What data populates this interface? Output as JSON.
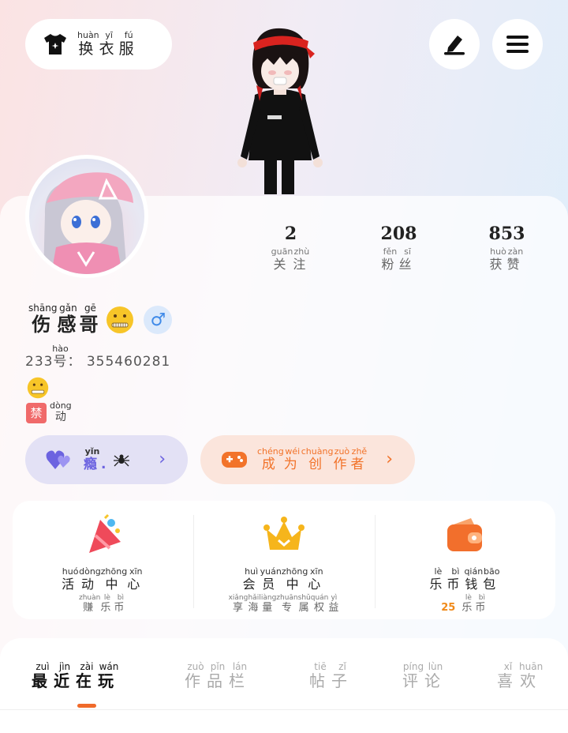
{
  "header": {
    "change_outfit": {
      "label": "换衣服",
      "pinyin": [
        "huàn",
        "yī",
        "fú"
      ],
      "icon": "tshirt-icon"
    },
    "edit_icon": "pen-icon",
    "menu_icon": "menu-icon"
  },
  "profile": {
    "name_chars": [
      "伤",
      "感",
      "哥"
    ],
    "name_pinyin": [
      "shāng",
      "gǎn",
      "gē"
    ],
    "name_emoji": "zipper-mouth-face",
    "gender_symbol": "♂",
    "uid_prefix": "233",
    "uid_label": "号",
    "uid_label_pinyin": "hào",
    "uid_value": "355460281",
    "status_emoji": "zipper-mouth-face",
    "banned_tag": "禁",
    "banned_text": "动",
    "banned_text_pinyin": "dòng"
  },
  "stats": [
    {
      "value": "2",
      "label": [
        "关",
        "注"
      ],
      "pinyin": [
        "guān",
        "zhù"
      ]
    },
    {
      "value": "208",
      "label": [
        "粉",
        "丝"
      ],
      "pinyin": [
        "fěn",
        "sī"
      ]
    },
    {
      "value": "853",
      "label": [
        "获",
        "赞"
      ],
      "pinyin": [
        "huò",
        "zàn"
      ]
    }
  ],
  "pills": {
    "purple": {
      "text": "瘾",
      "pinyin": "yǐn",
      "suffix": ".",
      "icon": "hearts-icon",
      "extra_icon": "spider-icon"
    },
    "orange": {
      "chars": [
        "成",
        "为",
        "创",
        "作",
        "者"
      ],
      "pinyin": [
        "chéng",
        "wéi",
        "chuàng",
        "zuò",
        "zhě"
      ],
      "icon": "gamepad-icon"
    }
  },
  "features": [
    {
      "title": [
        "活",
        "动",
        "中",
        "心"
      ],
      "title_pinyin": [
        "huó",
        "dòng",
        "zhōng",
        "xīn"
      ],
      "sub": [
        "赚",
        "乐",
        "币"
      ],
      "sub_pinyin": [
        "zhuàn",
        "lè",
        "bì"
      ],
      "icon": "party-icon"
    },
    {
      "title": [
        "会",
        "员",
        "中",
        "心"
      ],
      "title_pinyin": [
        "huì",
        "yuán",
        "zhōng",
        "xīn"
      ],
      "sub": [
        "享",
        "海",
        "量",
        "专",
        "属",
        "权",
        "益"
      ],
      "sub_pinyin": [
        "xiǎng",
        "hǎi",
        "liàng",
        "zhuān",
        "shǔ",
        "quán",
        "yì"
      ],
      "icon": "crown-icon"
    },
    {
      "title": [
        "乐",
        "币",
        "钱",
        "包"
      ],
      "title_pinyin": [
        "lè",
        "bì",
        "qián",
        "bāo"
      ],
      "sub": [
        "乐",
        "币"
      ],
      "sub_pinyin": [
        "lè",
        "bì"
      ],
      "sub_number": "25",
      "icon": "wallet-icon"
    }
  ],
  "tabs": [
    {
      "chars": [
        "最",
        "近",
        "在",
        "玩"
      ],
      "pinyin": [
        "zuì",
        "jìn",
        "zài",
        "wán"
      ],
      "active": true
    },
    {
      "chars": [
        "作",
        "品",
        "栏"
      ],
      "pinyin": [
        "zuò",
        "pǐn",
        "lán"
      ],
      "active": false
    },
    {
      "chars": [
        "帖",
        "子"
      ],
      "pinyin": [
        "tiē",
        "zǐ"
      ],
      "active": false
    },
    {
      "chars": [
        "评",
        "论"
      ],
      "pinyin": [
        "píng",
        "lùn"
      ],
      "active": false
    },
    {
      "chars": [
        "喜",
        "欢"
      ],
      "pinyin": [
        "xǐ",
        "huān"
      ],
      "active": false
    }
  ],
  "colors": {
    "accent_orange": "#f06a2a",
    "gender_blue": "#3f8ae8",
    "coin_orange": "#f08a1a",
    "banned_red": "#f06a6a"
  }
}
